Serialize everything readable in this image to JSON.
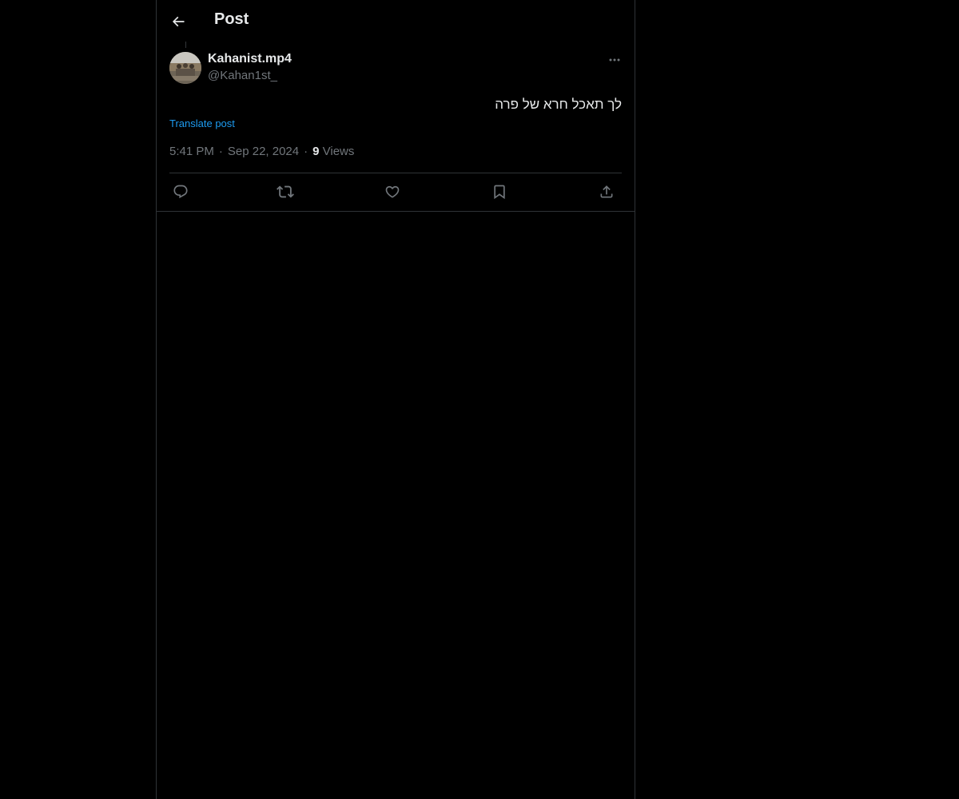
{
  "header": {
    "title": "Post",
    "back_icon": "arrow-left-icon"
  },
  "post": {
    "author": {
      "display_name": "Kahanist.mp4",
      "handle": "@Kahan1st_"
    },
    "text": "לך תאכל חרא של פרה",
    "translate_label": "Translate post",
    "time": "5:41 PM",
    "separator": "·",
    "date": "Sep 22, 2024",
    "views_count": "9",
    "views_label": "Views"
  },
  "actions": [
    {
      "name": "reply",
      "icon": "reply-icon"
    },
    {
      "name": "repost",
      "icon": "repost-icon"
    },
    {
      "name": "like",
      "icon": "heart-icon"
    },
    {
      "name": "bookmark",
      "icon": "bookmark-icon"
    },
    {
      "name": "share",
      "icon": "share-icon"
    }
  ],
  "colors": {
    "background": "#000000",
    "text_primary": "#e7e9ea",
    "text_secondary": "#71767b",
    "link": "#1d9bf0",
    "border": "#2f3336"
  }
}
